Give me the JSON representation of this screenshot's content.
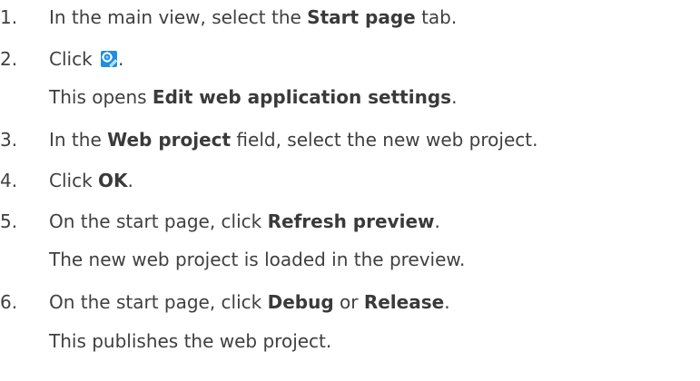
{
  "colors": {
    "text": "#3f3f3f",
    "icon_blue": "#1f8ee0",
    "icon_accent": "#7fd0ff"
  },
  "steps": [
    {
      "number": "1.",
      "pre": "In the main view, select the ",
      "bold": "Start page",
      "post": " tab."
    },
    {
      "number": "2.",
      "pre": "Click ",
      "icon": "settings-edit-icon",
      "post": ".",
      "note": {
        "pre": "This opens ",
        "bold": "Edit web application settings",
        "post": "."
      }
    },
    {
      "number": "3.",
      "pre": "In the ",
      "bold": "Web project",
      "post": " field, select the new web project."
    },
    {
      "number": "4.",
      "pre": "Click ",
      "bold": "OK",
      "post": "."
    },
    {
      "number": "5.",
      "pre": "On the start page, click ",
      "bold": "Refresh preview",
      "post": ".",
      "note": {
        "text": "The new web project is loaded in the preview."
      }
    },
    {
      "number": "6.",
      "pre": "On the start page, click ",
      "bold": "Debug",
      "mid": " or ",
      "bold2": "Release",
      "post": ".",
      "note": {
        "text": "This publishes the web project."
      }
    }
  ]
}
